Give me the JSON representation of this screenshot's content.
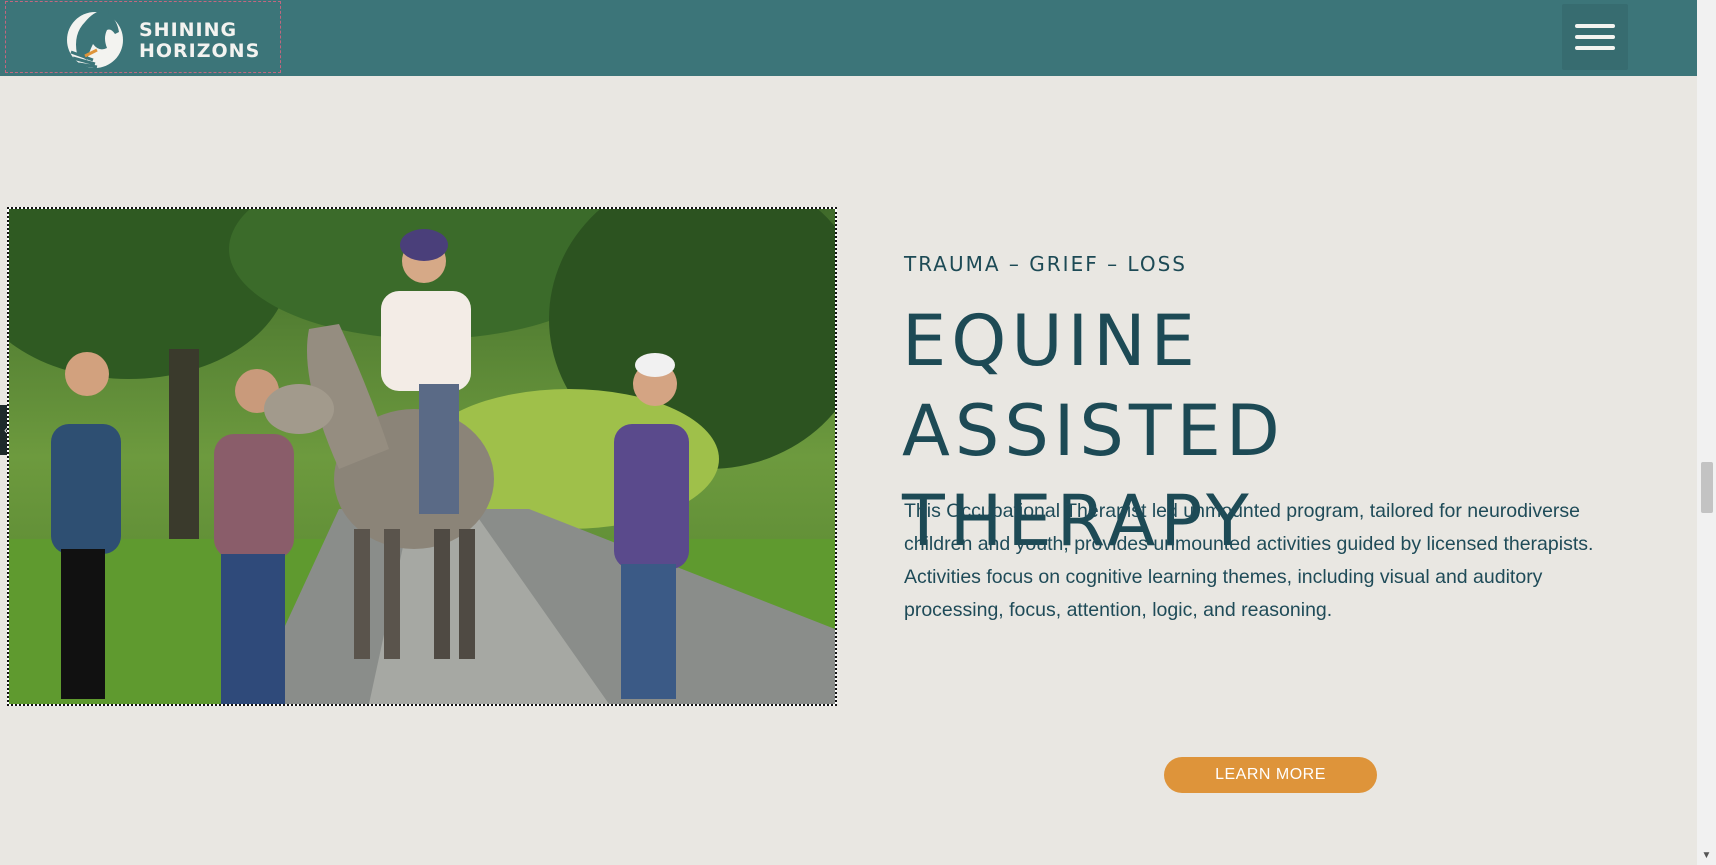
{
  "brand": {
    "line1": "SHINING",
    "line2": "HORIZONS"
  },
  "header": {
    "menu_icon": "hamburger-menu-icon",
    "bg_color": "#3c7579"
  },
  "hero": {
    "eyebrow": "TRAUMA – GRIEF – LOSS",
    "title": "EQUINE ASSISTED THERAPY",
    "description": "This Occupational Therapist led unmounted program, tailored for neurodiverse children and youth, provides unmounted activities guided by licensed therapists. Activities focus on cognitive learning themes, including visual and auditory processing, focus, attention, logic, and reasoning.",
    "cta_label": "LEARN MORE",
    "photo_icon": "horse-therapy-photo"
  },
  "slider": {
    "prev_glyph": "‹"
  },
  "colors": {
    "page_bg": "#e9e7e2",
    "heading": "#1d4a55",
    "accent": "#de943a"
  }
}
